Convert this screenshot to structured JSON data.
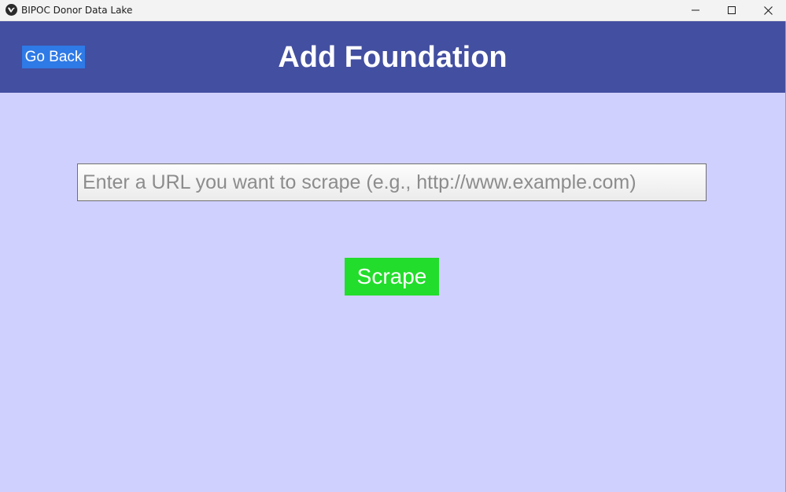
{
  "window": {
    "title": "BIPOC Donor Data Lake",
    "icon": "app-logo-icon",
    "controls": [
      "minimize-icon",
      "maximize-icon",
      "close-icon"
    ]
  },
  "header": {
    "back_label": "Go Back",
    "title": "Add Foundation",
    "background_color": "#434fa0",
    "back_button_color": "#2e7ae6"
  },
  "form": {
    "url_input": {
      "value": "",
      "placeholder": "Enter a URL you want to scrape (e.g., http://www.example.com)"
    },
    "submit_label": "Scrape",
    "submit_color": "#22dd2b"
  },
  "colors": {
    "page_background": "#d0d0ff"
  }
}
